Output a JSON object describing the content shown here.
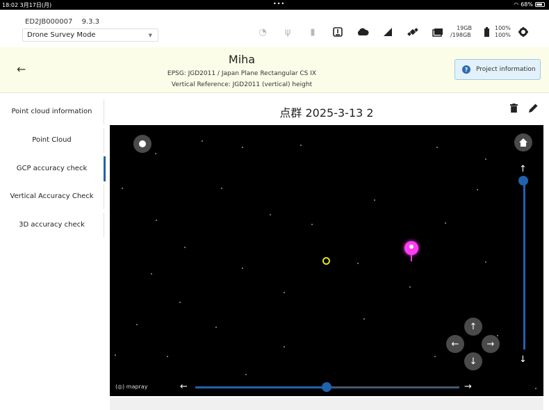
{
  "status_bar": {
    "time": "18:02",
    "date": "3月17日(月)",
    "dots": "•••",
    "battery": "68%"
  },
  "device": {
    "serial": "ED2JB000007",
    "version": "9.3.3",
    "mode": "Drone Survey Mode",
    "storage_used": "19GB",
    "storage_total": "/198GB",
    "battery_a": "100%",
    "battery_b": "100%"
  },
  "project": {
    "title": "Miha",
    "epsg": "EPSG: JGD2011 / Japan Plane Rectangular CS IX",
    "vertical": "Vertical Reference: JGD2011 (vertical) height",
    "info_button": "Project information"
  },
  "sidebar": {
    "items": [
      {
        "label": "Point cloud information",
        "active": false
      },
      {
        "label": "Point Cloud",
        "active": false
      },
      {
        "label": "GCP accuracy check",
        "active": true
      },
      {
        "label": "Vertical Accuracy Check",
        "active": false
      },
      {
        "label": "3D accuracy check",
        "active": false
      }
    ]
  },
  "content": {
    "title": "点群 2025-3-13 2",
    "brand": "mapray",
    "colors": {
      "accent": "#1f62ad",
      "gcp": "#e4e41c",
      "pin": "#ff3cf5"
    }
  }
}
